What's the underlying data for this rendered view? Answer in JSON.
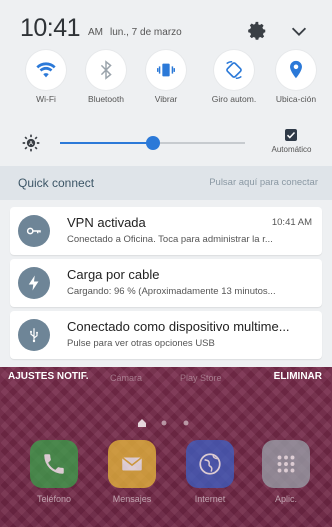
{
  "status": {
    "time": "10:41",
    "ampm": "AM",
    "date": "lun., 7 de marzo",
    "icons": [
      "gear-icon",
      "chevron-down-icon"
    ]
  },
  "quick_settings": [
    {
      "label": "Wi-Fi",
      "icon": "wifi-icon",
      "active": true
    },
    {
      "label": "Bluetooth",
      "icon": "bluetooth-icon",
      "active": false
    },
    {
      "label": "Vibrar",
      "icon": "vibrate-icon",
      "active": true
    },
    {
      "label": "Giro autom.",
      "icon": "rotate-icon",
      "active": true
    },
    {
      "label": "Ubica-ción",
      "icon": "location-icon",
      "active": true
    }
  ],
  "brightness": {
    "level": 0.5,
    "auto_label": "Automático",
    "auto_checked": true
  },
  "quick_connect": {
    "title": "Quick connect",
    "hint": "Pulsar aquí para conectar"
  },
  "notifications": [
    {
      "title": "VPN activada",
      "text": "Conectado a Oficina. Toca para administrar la r...",
      "time": "10:41 AM",
      "icon": "key-icon"
    },
    {
      "title": "Carga por cable",
      "text": "Cargando: 96 % (Aproximadamente 13 minutos...",
      "time": "",
      "icon": "lightning-icon"
    },
    {
      "title": "Conectado como dispositivo multime...",
      "text": "Pulse para ver otras opciones USB",
      "time": "",
      "icon": "usb-icon"
    }
  ],
  "actions": {
    "left": "AJUSTES NOTIF.",
    "right": "ELIMINAR",
    "behind_labels": [
      "Cámara",
      "Play Store"
    ]
  },
  "dock": [
    {
      "label": "Teléfono",
      "icon": "phone-icon",
      "color": "#3aa24a"
    },
    {
      "label": "Mensajes",
      "icon": "message-icon",
      "color": "#e8b93a"
    },
    {
      "label": "Internet",
      "icon": "globe-icon",
      "color": "#3d5fc4"
    },
    {
      "label": "Aplic.",
      "icon": "apps-icon",
      "color": "#9aa3ab"
    }
  ],
  "colors": {
    "accent": "#2b79d8",
    "shade_bg": "#eef0f2",
    "quick_connect_bg": "#dfe4e9"
  }
}
